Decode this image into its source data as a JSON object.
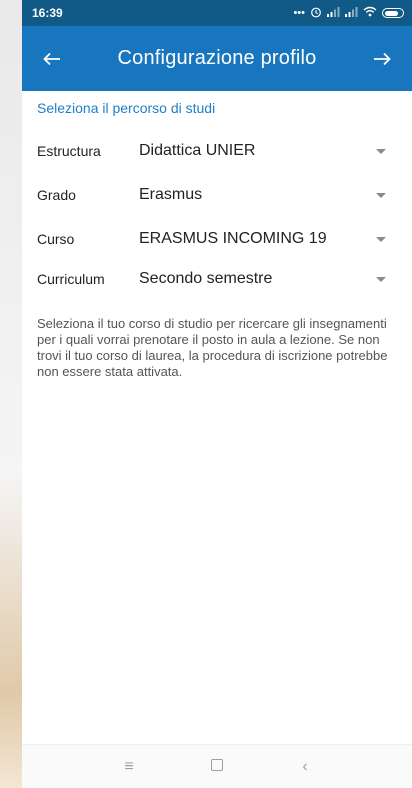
{
  "status_bar": {
    "time": "16:39",
    "icons": [
      "more-dots-icon",
      "alarm-icon",
      "signal-icon",
      "signal-icon",
      "wifi-icon",
      "battery-icon"
    ]
  },
  "app_bar": {
    "title": "Configurazione profilo",
    "back_icon": "arrow-left-icon",
    "forward_icon": "arrow-right-icon"
  },
  "section": {
    "title": "Seleziona il percorso di studi"
  },
  "fields": [
    {
      "label": "Estructura",
      "value": "Didattica UNIER"
    },
    {
      "label": "Grado",
      "value": "Erasmus"
    },
    {
      "label": "Curso",
      "value": "ERASMUS INCOMING 19"
    },
    {
      "label": "Curriculum",
      "value": "Secondo semestre"
    }
  ],
  "help_text": "Seleziona il tuo corso di studio per ricercare gli insegnamenti per i quali vorrai prenotare il posto in aula a lezione. Se non trovi il tuo corso di laurea, la procedura di iscrizione potrebbe non essere stata attivata.",
  "nav_bar": {
    "icons": [
      "menu-icon",
      "home-icon",
      "back-icon"
    ]
  },
  "colors": {
    "status_bar": "#115a87",
    "app_bar": "#1876bf",
    "accent": "#1f7fc8"
  }
}
